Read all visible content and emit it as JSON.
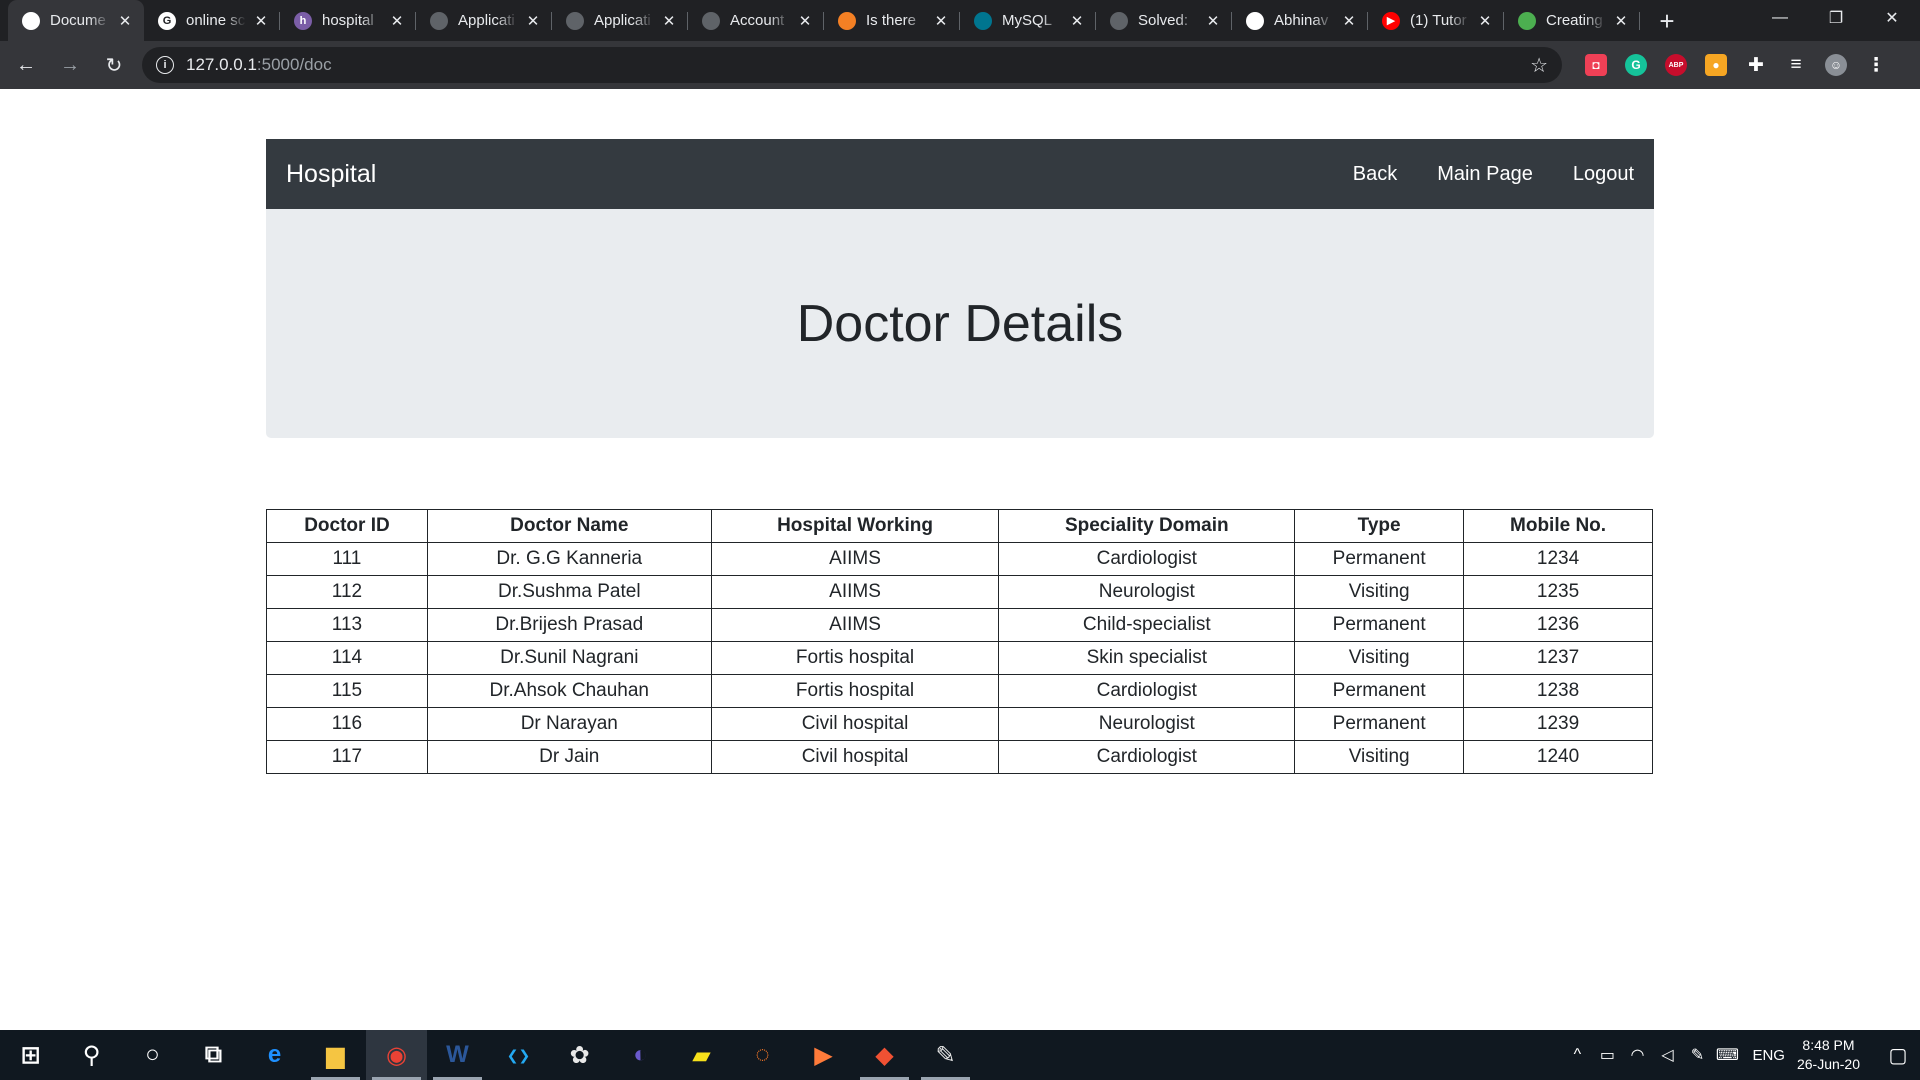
{
  "tabs": [
    {
      "title": "Docume",
      "active": true,
      "fav_color": "#ffffff",
      "fav_glyph": ""
    },
    {
      "title": "online sc",
      "fav_color": "#ffffff",
      "fav_glyph": "G"
    },
    {
      "title": "hospital",
      "fav_color": "#7b5ea7",
      "fav_glyph": "h"
    },
    {
      "title": "Applicati",
      "fav_color": "#5f6368",
      "fav_glyph": ""
    },
    {
      "title": "Applicati",
      "fav_color": "#5f6368",
      "fav_glyph": ""
    },
    {
      "title": "Account",
      "fav_color": "#5f6368",
      "fav_glyph": ""
    },
    {
      "title": "Is there",
      "fav_color": "#f48024",
      "fav_glyph": ""
    },
    {
      "title": "MySQL",
      "fav_color": "#00758f",
      "fav_glyph": ""
    },
    {
      "title": "Solved:",
      "fav_color": "#5f6368",
      "fav_glyph": ""
    },
    {
      "title": "Abhinav",
      "fav_color": "#ffffff",
      "fav_glyph": ""
    },
    {
      "title": "(1) Tutor",
      "fav_color": "#ff0000",
      "fav_glyph": "▶"
    },
    {
      "title": "Creating",
      "fav_color": "#4caf50",
      "fav_glyph": ""
    }
  ],
  "address_bar": {
    "host": "127.0.0.1",
    "path": ":5000/doc"
  },
  "extensions": [
    {
      "name": "pocket-icon",
      "color": "#ef4056",
      "glyph": "◘"
    },
    {
      "name": "grammarly-icon",
      "color": "#15c39a",
      "glyph": "G"
    },
    {
      "name": "adblock-plus-icon",
      "color": "#c70d2c",
      "glyph": "ABP"
    },
    {
      "name": "honey-icon",
      "color": "#f6a623",
      "glyph": "●"
    },
    {
      "name": "extensions-puzzle-icon",
      "color": "#35363a",
      "glyph": "✚"
    },
    {
      "name": "media-queue-icon",
      "color": "#35363a",
      "glyph": "≡"
    },
    {
      "name": "profile-avatar-icon",
      "color": "#8a8f96",
      "glyph": "☺"
    },
    {
      "name": "chrome-menu-icon",
      "color": "#35363a",
      "glyph": "⋮"
    }
  ],
  "navbar": {
    "brand": "Hospital",
    "links": [
      "Back",
      "Main Page",
      "Logout"
    ]
  },
  "page_title": "Doctor Details",
  "table": {
    "headers": [
      "Doctor ID",
      "Doctor Name",
      "Hospital Working",
      "Speciality Domain",
      "Type",
      "Mobile No."
    ],
    "rows": [
      [
        "111",
        "Dr. G.G Kanneria",
        "AIIMS",
        "Cardiologist",
        "Permanent",
        "1234"
      ],
      [
        "112",
        "Dr.Sushma Patel",
        "AIIMS",
        "Neurologist",
        "Visiting",
        "1235"
      ],
      [
        "113",
        "Dr.Brijesh Prasad",
        "AIIMS",
        "Child-specialist",
        "Permanent",
        "1236"
      ],
      [
        "114",
        "Dr.Sunil Nagrani",
        "Fortis hospital",
        "Skin specialist",
        "Visiting",
        "1237"
      ],
      [
        "115",
        "Dr.Ahsok Chauhan",
        "Fortis hospital",
        "Cardiologist",
        "Permanent",
        "1238"
      ],
      [
        "116",
        "Dr Narayan",
        "Civil hospital",
        "Neurologist",
        "Permanent",
        "1239"
      ],
      [
        "117",
        "Dr Jain",
        "Civil hospital",
        "Cardiologist",
        "Visiting",
        "1240"
      ]
    ]
  },
  "taskbar": {
    "apps": [
      {
        "name": "start-icon",
        "glyph": "⊞",
        "color": "#ffffff"
      },
      {
        "name": "search-icon",
        "glyph": "⚲",
        "color": "#ffffff"
      },
      {
        "name": "cortana-icon",
        "glyph": "○",
        "color": "#ffffff"
      },
      {
        "name": "task-view-icon",
        "glyph": "⧉",
        "color": "#ffffff"
      },
      {
        "name": "edge-icon",
        "glyph": "e",
        "color": "#1e90ff"
      },
      {
        "name": "file-explorer-icon",
        "glyph": "▆",
        "color": "#f5c542",
        "running": true
      },
      {
        "name": "chrome-icon",
        "glyph": "◉",
        "color": "#e94235",
        "running": true,
        "active": true
      },
      {
        "name": "word-icon",
        "glyph": "W",
        "color": "#2b579a",
        "running": true
      },
      {
        "name": "vscode-icon",
        "glyph": "❮❯",
        "color": "#23a9f2"
      },
      {
        "name": "paint-3d-icon",
        "glyph": "✿",
        "color": "#e8e8e8"
      },
      {
        "name": "eclipse-icon",
        "glyph": "◐",
        "color": "#6a5acd"
      },
      {
        "name": "sticky-notes-icon",
        "glyph": "▰",
        "color": "#f7e11b"
      },
      {
        "name": "jupyter-icon",
        "glyph": "◌",
        "color": "#f37626"
      },
      {
        "name": "powerpoint-icon",
        "glyph": "▶",
        "color": "#ff7b3a"
      },
      {
        "name": "git-icon",
        "glyph": "◆",
        "color": "#f05133",
        "running": true
      },
      {
        "name": "paint-icon",
        "glyph": "✎",
        "color": "#e8e8e8",
        "running": true
      }
    ],
    "tray": {
      "language": "ENG",
      "time": "8:48 PM",
      "date": "26-Jun-20"
    }
  }
}
